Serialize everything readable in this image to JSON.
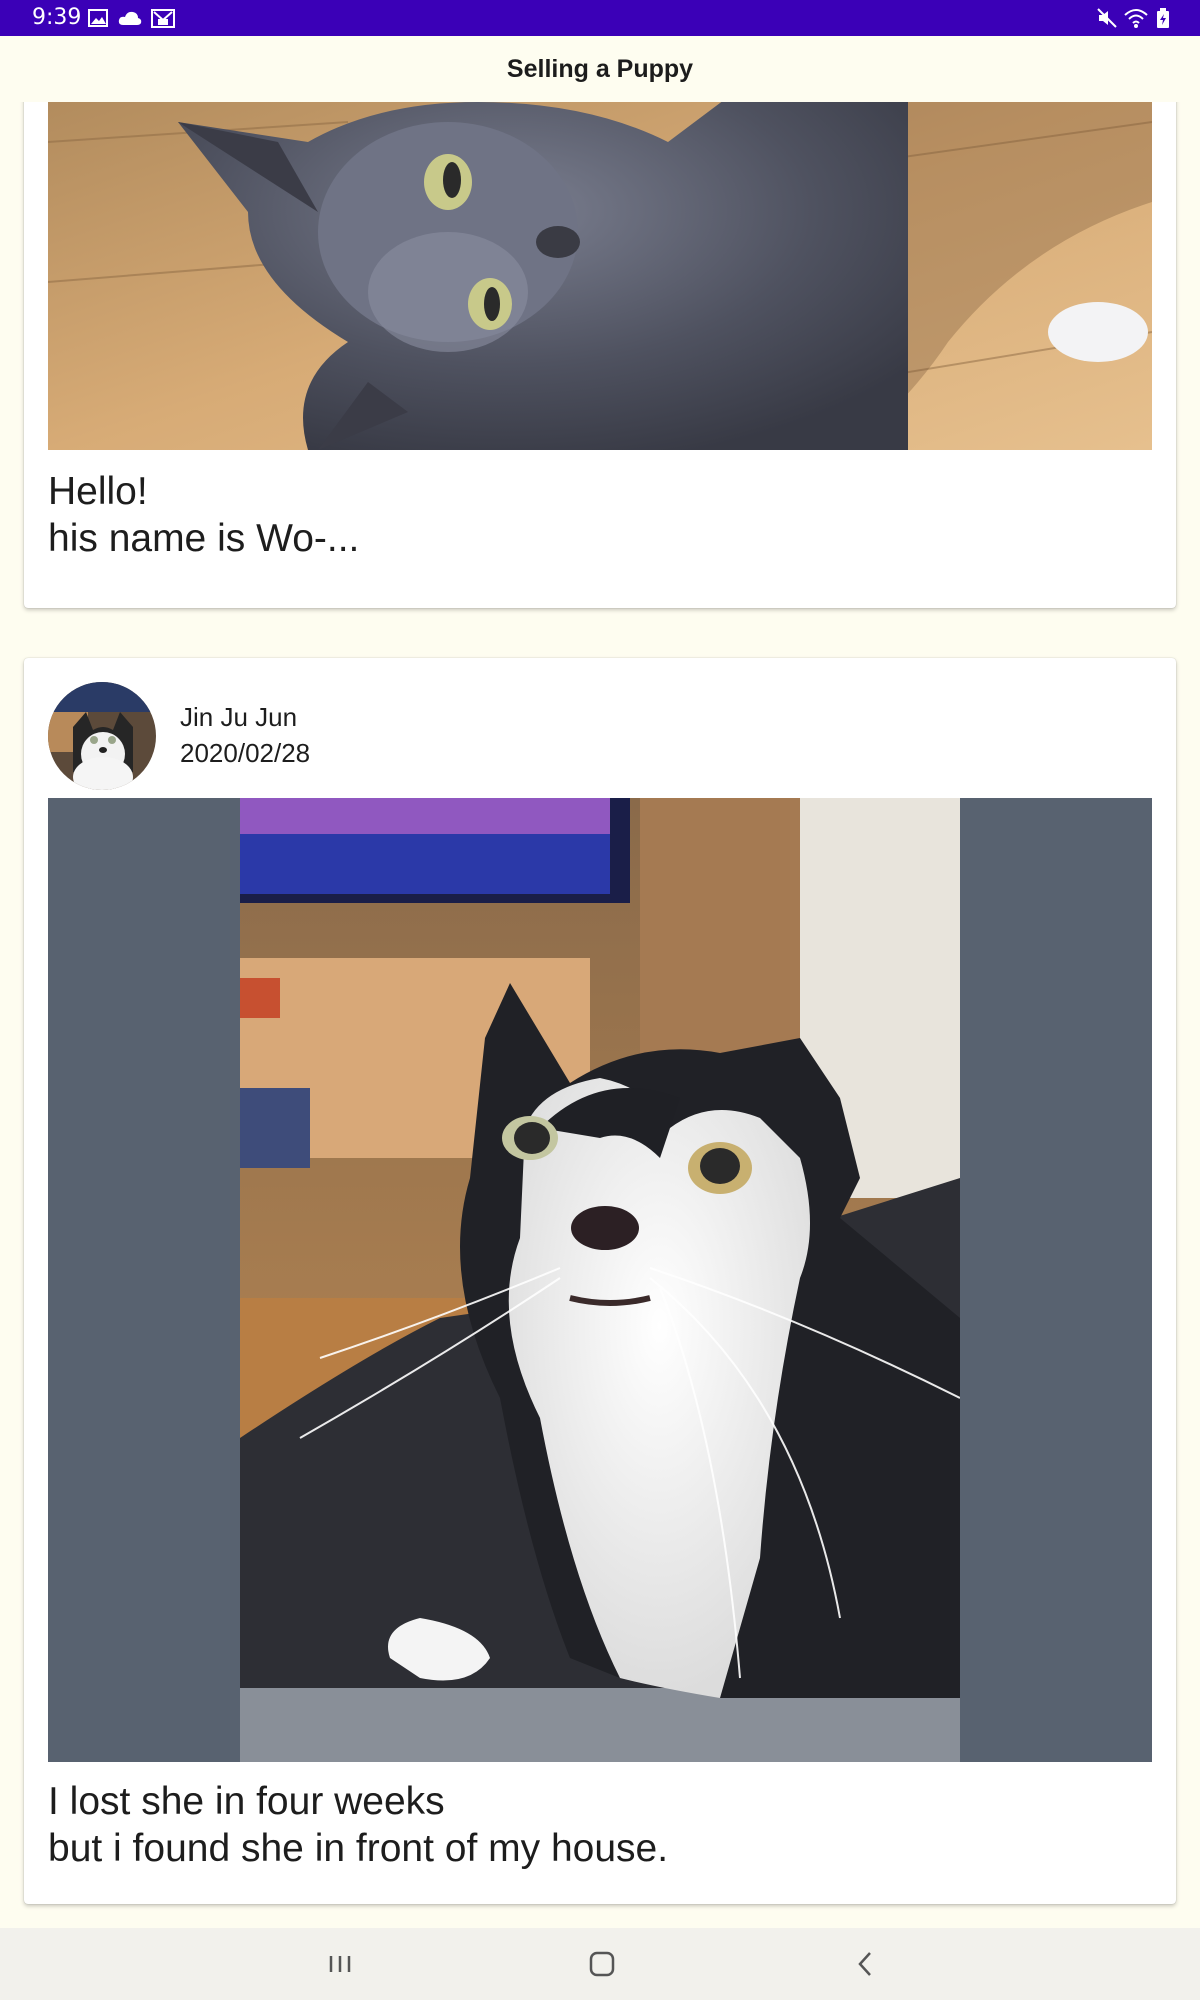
{
  "status_bar": {
    "time": "9:39",
    "left_icons": [
      "image-icon",
      "cloud-icon",
      "gmail-icon"
    ],
    "right_icons": [
      "mute-icon",
      "wifi-icon",
      "battery-icon"
    ]
  },
  "app_bar": {
    "title": "Selling a Puppy"
  },
  "posts": [
    {
      "image_subject": "gray cat looking up on wooden floor",
      "caption_line1": "Hello!",
      "caption_line2": "his name is Wo-..."
    },
    {
      "author": "Jin Ju Jun",
      "date": "2020/02/28",
      "image_subject": "black and white cat looking up",
      "caption_line1": "I lost she in four weeks",
      "caption_line2": "but i found she in front of my house."
    }
  ],
  "nav_bar": {
    "buttons": [
      "recents-icon",
      "home-icon",
      "back-icon"
    ]
  },
  "colors": {
    "status_bar": "#3b00b7",
    "background": "#fefdf0",
    "image_letterbox": "#586270"
  }
}
